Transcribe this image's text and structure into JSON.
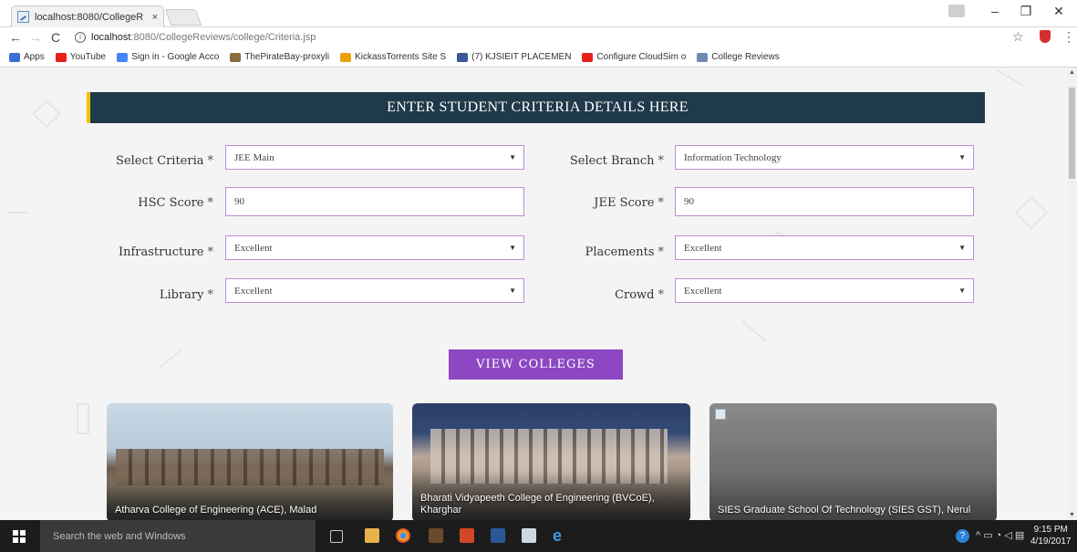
{
  "browser": {
    "tab_title": "localhost:8080/CollegeR",
    "tab_close": "×",
    "url_host": "localhost",
    "url_path": ":8080/CollegeReviews/college/Criteria.jsp",
    "info_glyph": "i",
    "bookmarks": [
      {
        "label": "Apps",
        "icon": "apps-grid-icon",
        "color": "#3b6fd6"
      },
      {
        "label": "YouTube",
        "icon": "youtube-icon",
        "color": "#e62117"
      },
      {
        "label": "Sign in - Google Acco",
        "icon": "google-icon",
        "color": "#4285f4"
      },
      {
        "label": "ThePirateBay-proxyli",
        "icon": "pirate-ship-icon",
        "color": "#8a6d3b"
      },
      {
        "label": "KickassTorrents Site S",
        "icon": "kickass-icon",
        "color": "#e9a20e"
      },
      {
        "label": "(7) KJSIEIT PLACEMEN",
        "icon": "facebook-icon",
        "color": "#3b5998"
      },
      {
        "label": "Configure CloudSim o",
        "icon": "youtube-icon",
        "color": "#e62117"
      },
      {
        "label": "College Reviews",
        "icon": "page-icon",
        "color": "#6d8bb3"
      }
    ]
  },
  "form": {
    "header": "ENTER STUDENT CRITERIA DETAILS HERE",
    "required_mark": "*",
    "fields": {
      "criteria": {
        "label": "Select Criteria",
        "value": "JEE Main"
      },
      "branch": {
        "label": "Select Branch",
        "value": "Information Technology"
      },
      "hsc": {
        "label": "HSC Score",
        "value": "90"
      },
      "jee": {
        "label": "JEE Score",
        "value": "90"
      },
      "infrastructure": {
        "label": "Infrastructure",
        "value": "Excellent"
      },
      "placements": {
        "label": "Placements",
        "value": "Excellent"
      },
      "library": {
        "label": "Library",
        "value": "Excellent"
      },
      "crowd": {
        "label": "Crowd",
        "value": "Excellent"
      }
    },
    "submit_label": "VIEW COLLEGES"
  },
  "colleges": [
    {
      "name": "Atharva College of Engineering (ACE), Malad"
    },
    {
      "name": "Bharati Vidyapeeth College of Engineering (BVCoE), Kharghar"
    },
    {
      "name": "SIES Graduate School Of Technology (SIES GST), Nerul"
    }
  ],
  "taskbar": {
    "search_placeholder": "Search the web and Windows",
    "time": "9:15 PM",
    "date": "4/19/2017",
    "help_glyph": "?"
  },
  "colors": {
    "header_bg": "#1f3a4a",
    "header_accent": "#f2c200",
    "button_bg": "#8e47c3",
    "field_border": "#b98ed6"
  }
}
